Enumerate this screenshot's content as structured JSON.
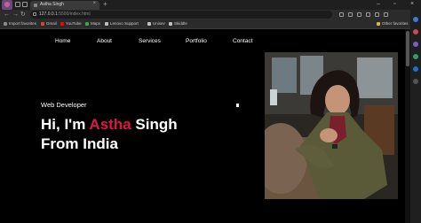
{
  "browser": {
    "tab_title": "Astha Singh",
    "url_host": "127.0.0.1",
    "url_path": ":5500/index.html",
    "bookmarks": [
      {
        "label": "Import favorites",
        "color": "#8a8a8a"
      },
      {
        "label": "Gmail",
        "color": "#d44638"
      },
      {
        "label": "YouTube",
        "color": "#ff0000"
      },
      {
        "label": "Maps",
        "color": "#34a853"
      },
      {
        "label": "Lenovo Support",
        "color": "#c0c0c0"
      },
      {
        "label": "Unisev",
        "color": "#c0c0c0"
      },
      {
        "label": "Skiddle",
        "color": "#c0c0c0"
      }
    ],
    "other_favorites": "Other favorites"
  },
  "nav": {
    "items": [
      "Home",
      "About",
      "Services",
      "Portfolio",
      "Contact"
    ]
  },
  "hero": {
    "eyebrow": "Web Developer",
    "line1_prefix": "Hi, I'm ",
    "line1_accent": "Astha",
    "line1_suffix": " Singh",
    "line2": "From India"
  },
  "colors": {
    "accent": "#e0134a",
    "background": "#000000",
    "text": "#ffffff"
  }
}
